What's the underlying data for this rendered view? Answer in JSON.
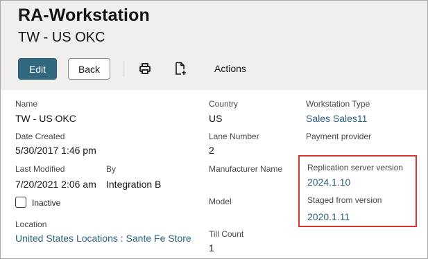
{
  "header": {
    "title": "RA-Workstation",
    "subtitle": "TW - US OKC"
  },
  "toolbar": {
    "edit_label": "Edit",
    "back_label": "Back",
    "actions_label": "Actions",
    "print_icon": "print-icon",
    "export_icon": "document-export-icon"
  },
  "fields": {
    "name_label": "Name",
    "name_value": "TW - US OKC",
    "date_created_label": "Date Created",
    "date_created_value": "5/30/2017 1:46 pm",
    "last_modified_label": "Last Modified",
    "last_modified_value": "7/20/2021 2:06 am",
    "by_label": "By",
    "by_value": "Integration B",
    "inactive_label": "Inactive",
    "inactive_checked": false,
    "location_label": "Location",
    "location_value": "United States Locations : Sante Fe Store",
    "country_label": "Country",
    "country_value": "US",
    "lane_number_label": "Lane Number",
    "lane_number_value": "2",
    "manufacturer_name_label": "Manufacturer Name",
    "model_label": "Model",
    "till_count_label": "Till Count",
    "till_count_value": "1",
    "workstation_type_label": "Workstation Type",
    "workstation_type_value": "Sales Sales11",
    "payment_provider_label": "Payment provider",
    "replication_server_version_label": "Replication server version",
    "replication_server_version_value": "2024.1.10",
    "staged_from_version_label": "Staged from version",
    "staged_from_version_value": "2020.1.11"
  },
  "colors": {
    "header_bg": "#f1efed",
    "primary_button": "#31677f",
    "link": "#2c6283",
    "highlight_box": "#d9352f"
  }
}
